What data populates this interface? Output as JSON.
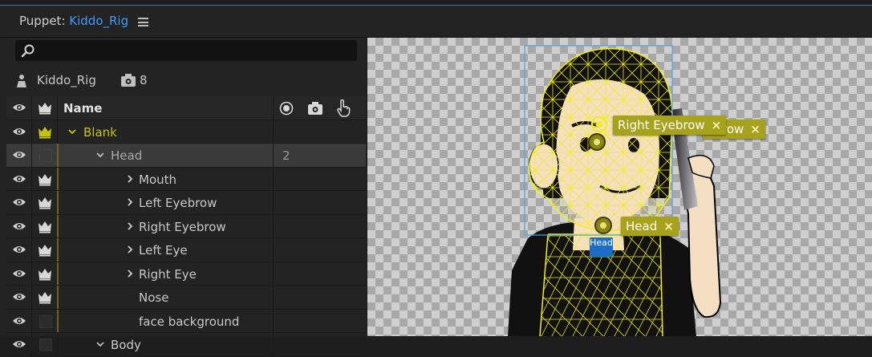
{
  "panel": {
    "title_prefix": "Puppet: ",
    "title_rig": "Kiddo_Rig",
    "search_placeholder": ""
  },
  "rig": {
    "name": "Kiddo_Rig",
    "camera_count": "8"
  },
  "table": {
    "header_name": "Name",
    "rows": [
      {
        "label": "Blank",
        "indent": 1,
        "expanded": true,
        "crown": "yellow",
        "num": ""
      },
      {
        "label": "Head",
        "indent": 2,
        "expanded": true,
        "crown": "none",
        "num": "2"
      },
      {
        "label": "Mouth",
        "indent": 3,
        "expanded": false,
        "crown": "white",
        "num": ""
      },
      {
        "label": "Left Eyebrow",
        "indent": 3,
        "expanded": false,
        "crown": "white",
        "num": ""
      },
      {
        "label": "Right Eyebrow",
        "indent": 3,
        "expanded": false,
        "crown": "white",
        "num": ""
      },
      {
        "label": "Left Eye",
        "indent": 3,
        "expanded": false,
        "crown": "white",
        "num": ""
      },
      {
        "label": "Right Eye",
        "indent": 3,
        "expanded": false,
        "crown": "white",
        "num": ""
      },
      {
        "label": "Nose",
        "indent": 3,
        "expanded": null,
        "crown": "white",
        "num": ""
      },
      {
        "label": "face background",
        "indent": 3,
        "expanded": null,
        "crown": "none",
        "num": ""
      },
      {
        "label": "Body",
        "indent": 2,
        "expanded": true,
        "crown": "none",
        "num": ""
      }
    ]
  },
  "canvas": {
    "tag_right_eyebrow": "Right Eyebrow",
    "tag_behind_suffix": "row",
    "tag_head": "Head",
    "head_marker": "Head",
    "close_glyph": "×"
  },
  "colors": {
    "accent_blue": "#3d9bff",
    "tag_yellow": "#a7a21c",
    "mesh_yellow": "#f2ee1a"
  }
}
